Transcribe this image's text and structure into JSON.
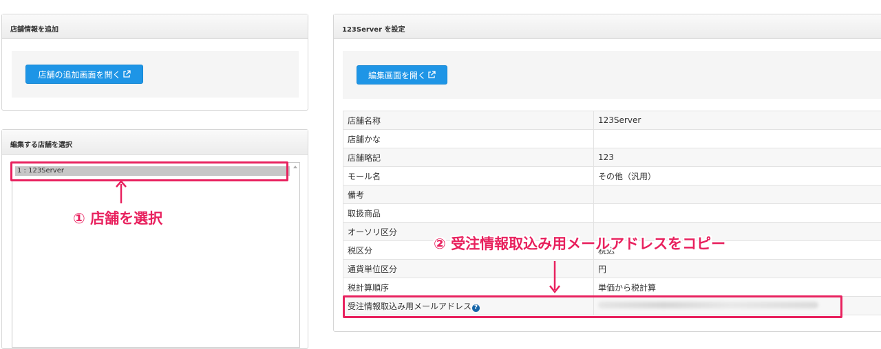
{
  "left_top_panel": {
    "title": "店舗情報を追加",
    "button_label": "店舗の追加画面を開く"
  },
  "left_bottom_panel": {
    "title": "編集する店舗を選択",
    "list_items": [
      "1 : 123Server"
    ]
  },
  "right_panel": {
    "title": "123Server を設定",
    "button_label": "編集画面を開く",
    "rows": [
      {
        "label": "店舗名称",
        "value": "123Server"
      },
      {
        "label": "店舗かな",
        "value": ""
      },
      {
        "label": "店舗略記",
        "value": "123"
      },
      {
        "label": "モール名",
        "value": "その他（汎用）"
      },
      {
        "label": "備考",
        "value": ""
      },
      {
        "label": "取扱商品",
        "value": ""
      },
      {
        "label": "オーソリ区分",
        "value": ""
      },
      {
        "label": "税区分",
        "value": "税込"
      },
      {
        "label": "通貨単位区分",
        "value": "円"
      },
      {
        "label": "税計算順序",
        "value": "単価から税計算"
      },
      {
        "label": "受注情報取込み用メールアドレス",
        "value": ""
      }
    ]
  },
  "annotations": {
    "step1": "① 店舗を選択",
    "step2": "② 受注情報取込み用メールアドレスをコピー"
  },
  "colors": {
    "accent": "#e8215e",
    "button": "#1e95e6"
  }
}
